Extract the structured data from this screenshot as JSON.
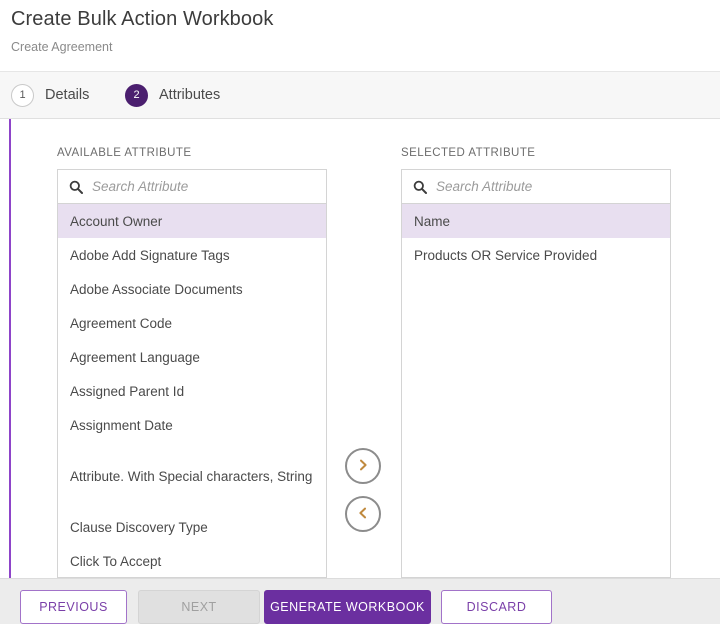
{
  "header": {
    "title": "Create Bulk Action Workbook",
    "subtitle": "Create Agreement"
  },
  "stepper": {
    "steps": [
      {
        "number": "1",
        "label": "Details",
        "active": false
      },
      {
        "number": "2",
        "label": "Attributes",
        "active": true
      }
    ]
  },
  "available_panel": {
    "label": "AVAILABLE ATTRIBUTE",
    "search": {
      "placeholder": "Search Attribute",
      "value": "",
      "icon": "search-icon"
    },
    "items": [
      {
        "label": "Account Owner",
        "selected": true
      },
      {
        "label": "Adobe Add Signature Tags",
        "selected": false
      },
      {
        "label": "Adobe Associate Documents",
        "selected": false
      },
      {
        "label": "Agreement Code",
        "selected": false
      },
      {
        "label": "Agreement Language",
        "selected": false
      },
      {
        "label": "Assigned Parent Id",
        "selected": false
      },
      {
        "label": "Assignment Date",
        "selected": false
      },
      {
        "label": "Attribute. With Special characters, String",
        "selected": false
      },
      {
        "label": "Clause Discovery Type",
        "selected": false
      },
      {
        "label": "Click To Accept",
        "selected": false
      }
    ]
  },
  "selected_panel": {
    "label": "SELECTED ATTRIBUTE",
    "search": {
      "placeholder": "Search Attribute",
      "value": "",
      "icon": "search-icon"
    },
    "items": [
      {
        "label": "Name",
        "selected": true
      },
      {
        "label": "Products OR Service Provided",
        "selected": false
      }
    ]
  },
  "transfer": {
    "move_right_icon": "chevron-right-icon",
    "move_left_icon": "chevron-left-icon"
  },
  "footer": {
    "previous_label": "PREVIOUS",
    "next_label": "NEXT",
    "generate_label": "GENERATE WORKBOOK",
    "discard_label": "DISCARD"
  },
  "colors": {
    "accent_purple": "#6b2fa0",
    "accent_line": "#8e44c9",
    "selected_row": "#e8dff0",
    "chevron": "#c08a3e",
    "footer_bg": "#ececec"
  }
}
